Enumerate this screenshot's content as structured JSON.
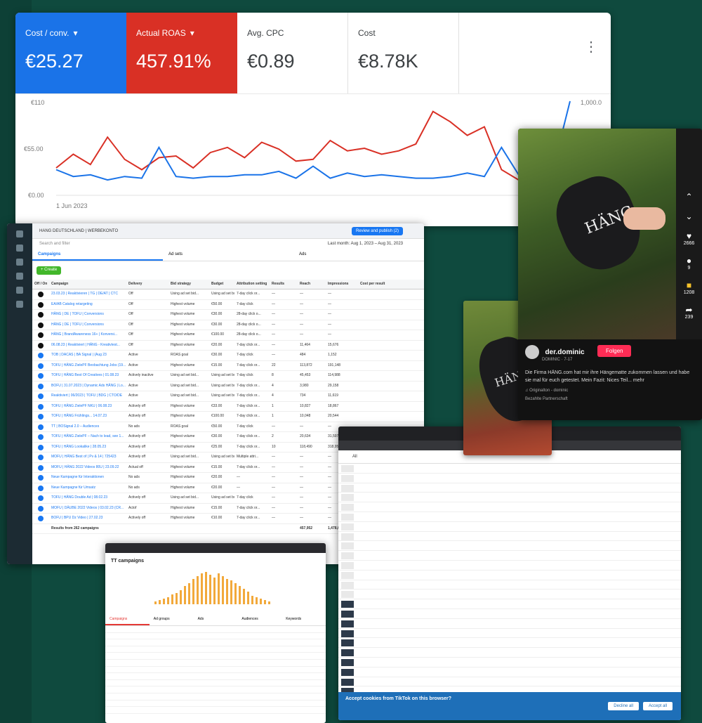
{
  "google_ads": {
    "kpis": [
      {
        "label": "Cost / conv.",
        "value": "€25.27",
        "color": "#1a73e8",
        "dropdown": true
      },
      {
        "label": "Actual ROAS",
        "value": "457.91%",
        "color": "#d93025",
        "dropdown": true
      },
      {
        "label": "Avg. CPC",
        "value": "€0.89",
        "color": "#ffffff",
        "dropdown": false
      },
      {
        "label": "Cost",
        "value": "€8.78K",
        "color": "#ffffff",
        "dropdown": false
      }
    ],
    "menu_icon": "more-vert-icon"
  },
  "chart_data": {
    "type": "line",
    "y_ticks": [
      "€110",
      "€55.00",
      "€0.00"
    ],
    "y_right_tick": "1,000.0",
    "x_label": "1 Jun 2023",
    "ylim": [
      0,
      110
    ],
    "series": [
      {
        "color": "#d93025",
        "values": [
          32,
          48,
          36,
          68,
          42,
          30,
          44,
          46,
          32,
          50,
          56,
          44,
          62,
          54,
          40,
          42,
          64,
          52,
          55,
          48,
          52,
          60,
          98,
          86,
          70,
          80,
          30,
          18,
          36,
          22,
          30
        ]
      },
      {
        "color": "#1a73e8",
        "values": [
          30,
          22,
          24,
          18,
          22,
          20,
          56,
          22,
          20,
          22,
          22,
          24,
          24,
          28,
          20,
          34,
          20,
          26,
          22,
          24,
          22,
          20,
          20,
          22,
          26,
          22,
          56,
          24,
          48,
          30,
          110
        ]
      }
    ]
  },
  "meta_ads": {
    "account": "HANG DEUTSCHLAND | WERBEKONTO",
    "review_btn": "Review and publish (2)",
    "date_range": "Last month: Aug 1, 2023 – Aug 31, 2023",
    "search_placeholder": "Search and filter",
    "tabs": [
      "Campaigns",
      "Ad sets",
      "Ads"
    ],
    "create": "+ Create",
    "columns": [
      "Off / On",
      "Campaign",
      "Delivery",
      "Bid strategy",
      "Budget",
      "Attribution setting",
      "Results",
      "Reach",
      "Impressions",
      "Cost per result"
    ],
    "rows": [
      {
        "on": false,
        "name": "23.03.23 | Reaktivieren | TG | DE/AT | CTC",
        "delivery": "Off",
        "bid": "Using ad set bid...",
        "budget": "Using ad set bu...",
        "attr": "7-day click or...",
        "results": "—",
        "reach": "—",
        "impr": "—"
      },
      {
        "on": false,
        "name": "EA/AB Catalog retargeting",
        "delivery": "Off",
        "bid": "Highest volume",
        "budget": "€50.00",
        "attr": "7-day click",
        "results": "—",
        "reach": "—",
        "impr": "—"
      },
      {
        "on": false,
        "name": "HÄNG | DE | TOFU | Conversions",
        "delivery": "Off",
        "bid": "Highest volume",
        "budget": "€30.00",
        "attr": "28-day click o...",
        "results": "—",
        "reach": "—",
        "impr": "—"
      },
      {
        "on": false,
        "name": "HÄNG | DE | TOFU | Conversions",
        "delivery": "Off",
        "bid": "Highest volume",
        "budget": "€30.00",
        "attr": "28-day click o...",
        "results": "—",
        "reach": "—",
        "impr": "—"
      },
      {
        "on": false,
        "name": "HÄNG | BrandAwareness 16+ | Konversi...",
        "delivery": "Off",
        "bid": "Highest volume",
        "budget": "€100.00",
        "attr": "28-day click o...",
        "results": "—",
        "reach": "—",
        "impr": "—"
      },
      {
        "on": false,
        "name": "06.08.23 | Reaktiviert | HÄNG - Kreativtest...",
        "delivery": "Off",
        "bid": "Highest volume",
        "budget": "€20.00",
        "attr": "7-day click or...",
        "results": "—",
        "reach": "11,464",
        "impr": "15,676"
      },
      {
        "on": true,
        "name": "TOB | DACAS | BA Signal | (Aug 23",
        "delivery": "Active",
        "bid": "ROAS goal",
        "budget": "€30.00",
        "attr": "7-day click",
        "results": "—",
        "reach": "484",
        "impr": "1,152"
      },
      {
        "on": true,
        "name": "TOFU | HÄNG ZielePF Beobachtung Jobs (19...",
        "delivery": "Active",
        "bid": "Highest volume",
        "budget": "€15.00",
        "attr": "7-day click or...",
        "results": "22",
        "reach": "113,872",
        "impr": "191,148"
      },
      {
        "on": true,
        "name": "TOFU | HÄNG Best Of Creatives | 01.08.23",
        "delivery": "Actively inactive",
        "bid": "Using ad set bid...",
        "budget": "Using ad set bu...",
        "attr": "7-day click",
        "results": "8",
        "reach": "45,453",
        "impr": "114,988"
      },
      {
        "on": true,
        "name": "BOFU | 31.07.2023 | Dynamic Ads HÄNG | Lo...",
        "delivery": "Active",
        "bid": "Using ad set bid...",
        "budget": "Using ad set bu...",
        "attr": "7-day click or...",
        "results": "4",
        "reach": "3,980",
        "impr": "29,158"
      },
      {
        "on": true,
        "name": "Reaktiviert | 06/2023 | TOFU | BDG | CTO/DE",
        "delivery": "Active",
        "bid": "Using ad set bid...",
        "budget": "Using ad set bu...",
        "attr": "7-day click or...",
        "results": "4",
        "reach": "734",
        "impr": "11,619"
      },
      {
        "on": true,
        "name": "TOFU | HÄNG ZielePF NKU | 06.08.23",
        "delivery": "Actively off",
        "bid": "Highest volume",
        "budget": "€33.00",
        "attr": "7-day click or...",
        "results": "1",
        "reach": "10,827",
        "impr": "18,867"
      },
      {
        "on": true,
        "name": "TOFU | HÄNG Frühlings... 14.07.23",
        "delivery": "Actively off",
        "bid": "Highest volume",
        "budget": "€100.00",
        "attr": "7-day click or...",
        "results": "1",
        "reach": "10,048",
        "impr": "20,544"
      },
      {
        "on": true,
        "name": "TT | BOSignal 2.0 – Audiences",
        "delivery": "No ads",
        "bid": "ROAS goal",
        "budget": "€50.00",
        "attr": "7-day click",
        "results": "—",
        "reach": "—",
        "impr": "—"
      },
      {
        "on": true,
        "name": "TOFU | HÄNG ZielePF – Nach to lead, see 1...",
        "delivery": "Actively off",
        "bid": "Highest volume",
        "budget": "€30.00",
        "attr": "7-day click or...",
        "results": "2",
        "reach": "20,634",
        "impr": "31,597"
      },
      {
        "on": true,
        "name": "TOFU | HÄNG Lookalike | 28.05.23",
        "delivery": "Actively off",
        "bid": "Highest volume",
        "budget": "€25.00",
        "attr": "7-day click or...",
        "results": "10",
        "reach": "118,490",
        "impr": "318,954"
      },
      {
        "on": true,
        "name": "MOFU | HÄNG Best of | Pv & 14 | 725423",
        "delivery": "Actively off",
        "bid": "Using ad set bid...",
        "budget": "Using ad set bu...",
        "attr": "Multiple attri...",
        "results": "—",
        "reach": "—",
        "impr": "—"
      },
      {
        "on": true,
        "name": "MOFU | HÄNG 2022 Videos 80U | 23.09.22",
        "delivery": "Actual off",
        "bid": "Highest volume",
        "budget": "€15.00",
        "attr": "7-day click or...",
        "results": "—",
        "reach": "—",
        "impr": "—"
      },
      {
        "on": true,
        "name": "Neue Kampagne für Interaktionen",
        "delivery": "No ads",
        "bid": "Highest volume",
        "budget": "€20.00",
        "attr": "—",
        "results": "—",
        "reach": "—",
        "impr": "—"
      },
      {
        "on": true,
        "name": "Neue Kampagne für Umsatz",
        "delivery": "No ads",
        "bid": "Highest volume",
        "budget": "€20.00",
        "attr": "—",
        "results": "—",
        "reach": "—",
        "impr": "—"
      },
      {
        "on": true,
        "name": "TOFU | HÄNG Double Ad | 08.02.23",
        "delivery": "Actively off",
        "bid": "Using ad set bid...",
        "budget": "Using ad set bu...",
        "attr": "7-day click",
        "results": "—",
        "reach": "—",
        "impr": "—"
      },
      {
        "on": true,
        "name": "MOFU | DÄUBE 2022 Videos | 03.02.23 (CR...",
        "delivery": "Actof",
        "bid": "Highest volume",
        "budget": "€15.00",
        "attr": "7-day click or...",
        "results": "—",
        "reach": "—",
        "impr": "—"
      },
      {
        "on": true,
        "name": "BOFU | BPU Dz Video | 27.02.23",
        "delivery": "Actively off",
        "bid": "Highest volume",
        "budget": "€10.00",
        "attr": "7-day click or...",
        "results": "—",
        "reach": "—",
        "impr": "—"
      }
    ],
    "footer": {
      "label": "Results from 262 campaigns",
      "reach": "457,952",
      "impr": "1,478,684"
    }
  },
  "tiktok_post": {
    "username": "der.dominic",
    "handle": "DOMINIC · 7-17",
    "follow": "Folgen",
    "description": "Die Firma HÄNG.com hat mir ihre Hängematte zukommen lassen und habe sie mal für euch getestet. Mein Fazit: Nices Teil... mehr",
    "sound": "♫ Originalton - dominic",
    "partner": "Bezahlte Partnerschaft",
    "likes": "2666",
    "comments": "9",
    "saves": "1208",
    "shares": "239",
    "brand": "HÄNG"
  },
  "tiktok_ads": {
    "tab": "All",
    "cookie_title": "Accept cookies from TikTok on this browser?",
    "cookie_decline": "Decline all",
    "cookie_accept": "Accept all"
  },
  "dashboard": {
    "title": "TT campaigns",
    "tabs": [
      "Campaigns",
      "Ad groups",
      "Ads",
      "Audiences",
      "Keywords"
    ],
    "bars": [
      4,
      6,
      8,
      10,
      14,
      16,
      20,
      26,
      30,
      36,
      40,
      44,
      46,
      42,
      38,
      44,
      40,
      36,
      34,
      30,
      26,
      22,
      18,
      12,
      10,
      8,
      6,
      4
    ]
  }
}
